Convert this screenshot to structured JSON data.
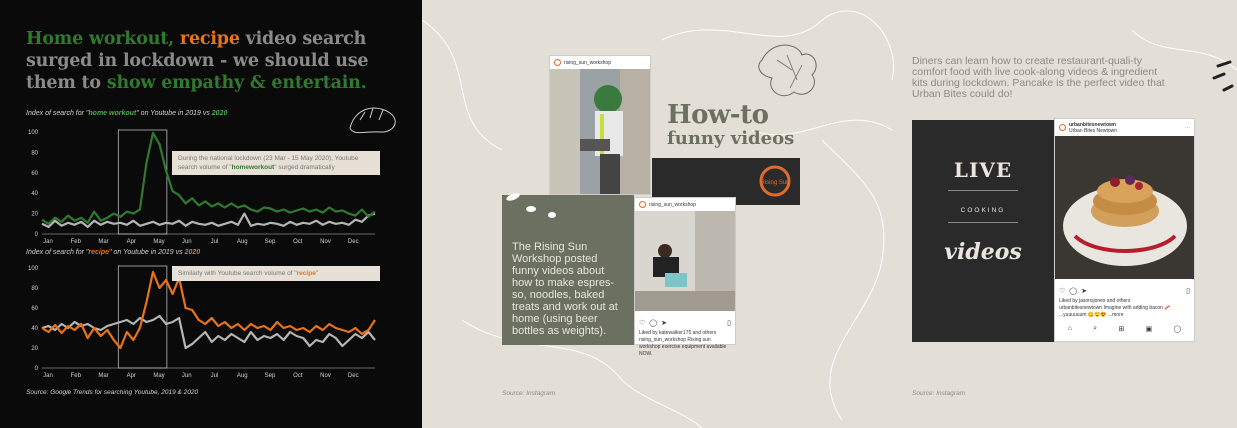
{
  "left": {
    "headline": {
      "p1": "Home workout,",
      "p2": " ",
      "p3": "recipe",
      "p4": " video search surged in lockdown - we should use them to ",
      "p5": "show empathy & entertain."
    },
    "chart1_label": {
      "pre": "Index of search for \"",
      "kw": "home workout",
      "mid": "\" on Youtube in 2019 vs ",
      "yr": "2020"
    },
    "chart2_label": {
      "pre": "Index of search for \"",
      "kw": "recipe",
      "mid": "\" on Youtube in 2019 vs ",
      "yr": "2020"
    },
    "annot1": {
      "a": "During the national lockdown (23 Mar - 15 May 2020), Youtube search volume of \"",
      "kw": "homeworkout",
      "b": "\" surged dramatically"
    },
    "annot2": {
      "a": "Similarly with Youtube search volume of \"",
      "kw": "recipe",
      "b": "\""
    },
    "source": "Source: Google Trends for searching Youtube, 2019 & 2020"
  },
  "chart_data": [
    {
      "type": "line",
      "title": "Index of search for \"home workout\" on Youtube in 2019 vs 2020",
      "x_ticks": [
        "Jan",
        "Feb",
        "Mar",
        "Apr",
        "May",
        "Jun",
        "Jul",
        "Aug",
        "Sep",
        "Oct",
        "Nov",
        "Dec"
      ],
      "y_ticks": [
        0,
        20,
        40,
        60,
        80,
        100
      ],
      "ylim": [
        0,
        100
      ],
      "series": [
        {
          "name": "2020",
          "color": "#2f7a2f",
          "values": [
            14,
            10,
            16,
            12,
            18,
            13,
            16,
            11,
            22,
            13,
            16,
            20,
            17,
            22,
            20,
            24,
            70,
            99,
            88,
            62,
            42,
            38,
            30,
            35,
            28,
            32,
            27,
            30,
            26,
            30,
            26,
            28,
            24,
            22,
            26,
            25,
            22,
            24,
            21,
            23,
            25,
            22,
            24,
            21,
            26,
            22,
            23,
            20,
            18,
            24,
            17,
            22
          ]
        },
        {
          "name": "2019",
          "color": "#b5b5b5",
          "values": [
            10,
            7,
            13,
            8,
            11,
            9,
            12,
            7,
            13,
            9,
            12,
            10,
            11,
            9,
            13,
            8,
            10,
            12,
            9,
            11,
            10,
            13,
            8,
            12,
            10,
            9,
            11,
            8,
            10,
            12,
            9,
            20,
            8,
            10,
            9,
            11,
            10,
            8,
            12,
            9,
            11,
            10,
            13,
            9,
            12,
            10,
            11,
            9,
            14,
            12,
            18,
            20
          ]
        }
      ]
    },
    {
      "type": "line",
      "title": "Index of search for \"recipe\" on Youtube in 2019 vs 2020",
      "x_ticks": [
        "Jan",
        "Feb",
        "Mar",
        "Apr",
        "May",
        "Jun",
        "Jul",
        "Aug",
        "Sep",
        "Oct",
        "Nov",
        "Dec"
      ],
      "y_ticks": [
        0,
        20,
        40,
        60,
        80,
        100
      ],
      "ylim": [
        0,
        100
      ],
      "series": [
        {
          "name": "2020",
          "color": "#e8731a",
          "values": [
            40,
            36,
            43,
            35,
            42,
            38,
            44,
            30,
            40,
            32,
            38,
            28,
            20,
            36,
            28,
            40,
            66,
            96,
            80,
            88,
            74,
            90,
            60,
            58,
            48,
            44,
            50,
            42,
            46,
            40,
            44,
            38,
            44,
            40,
            42,
            38,
            46,
            40,
            42,
            38,
            40,
            36,
            42,
            38,
            44,
            40,
            38,
            36,
            40,
            34,
            38,
            48
          ]
        },
        {
          "name": "2019",
          "color": "#b5b5b5",
          "values": [
            40,
            42,
            38,
            44,
            40,
            46,
            42,
            44,
            40,
            38,
            42,
            44,
            46,
            48,
            44,
            50,
            46,
            48,
            52,
            44,
            46,
            50,
            20,
            24,
            30,
            36,
            26,
            32,
            28,
            34,
            30,
            26,
            36,
            28,
            32,
            30,
            34,
            28,
            36,
            32,
            30,
            22,
            28,
            26,
            34,
            30,
            22,
            28,
            34,
            30,
            36,
            28
          ]
        }
      ]
    }
  ],
  "right": {
    "ig_user": "rising_sun_workshop",
    "howto_big": "How-to",
    "howto_small": "funny videos",
    "logo_text": "Rising Sun",
    "olive_text": "The Rising Sun Workshop posted funny videos about how to make espres-so, noodles, baked treats and work out at home (using beer bottles as weights).",
    "ig_caption1": "Liked by katewalker175 and others",
    "ig_caption2": "rising_sun_workshop Rising sun workshop exercise equipment available NOW.",
    "source1": "Source: Instagram",
    "diners_text": "Diners can learn how to create restaurant-quali-ty comfort food with live cook-along videos & ingredient kits during lockdown. Pancake is the perfect video that Urban Bites could do!",
    "live1": "LIVE",
    "live2": "COOKING",
    "live3": "videos",
    "ub_user": "urbanbitesnewtown",
    "ub_location": "Urban Bites Newtown",
    "ub_liked": "Liked by jasonsjones and others",
    "ub_caption": "urbanbitesnewtown Imagine with adding bacon 🥓 ...yuuuuuum 😋🤤😍 ...more",
    "source2": "Source: Instagram"
  },
  "colors": {
    "green": "#2f7a2f",
    "orange": "#e8731a",
    "olive": "#6b7061",
    "beige": "#e3dfd7"
  }
}
